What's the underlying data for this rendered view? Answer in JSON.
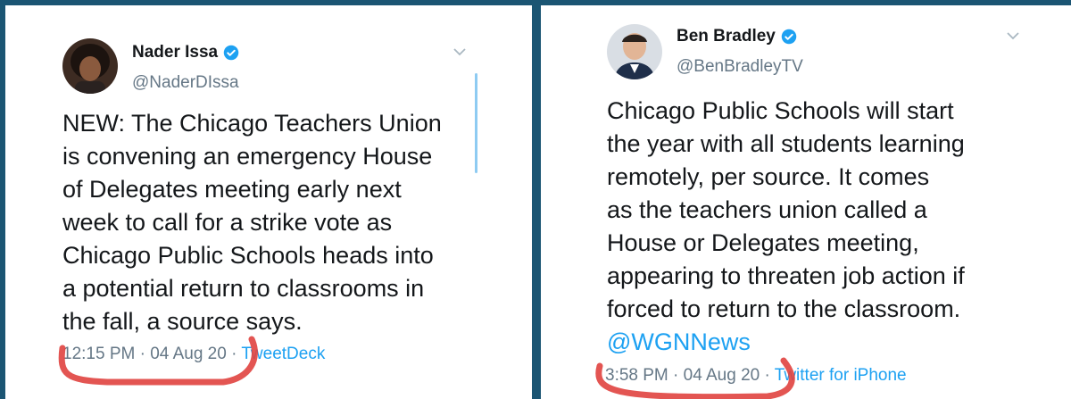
{
  "tweets": [
    {
      "author": "Nader Issa",
      "handle": "@NaderDIssa",
      "text": "NEW: The Chicago Teachers Union\nis convening an emergency House\nof Delegates meeting early next\nweek to call for a strike vote as\nChicago Public Schools heads into\na potential return to classrooms in\nthe fall, a source says.",
      "time": "12:15 PM · 04 Aug 20 ·",
      "source": "TweetDeck",
      "verified": true,
      "menu_icon": "chevron-down-icon"
    },
    {
      "author": "Ben Bradley",
      "handle": "@BenBradleyTV",
      "text": "Chicago Public Schools will start\nthe year with all students learning\nremotely, per source. It comes\nas the teachers union called a\nHouse or Delegates meeting,\nappearing to threaten job action if\nforced to return to the classroom.",
      "mention": "@WGNNews",
      "time": "3:58 PM · 04 Aug 20 ·",
      "source": "Twitter for iPhone",
      "verified": true,
      "menu_icon": "chevron-down-icon"
    }
  ],
  "colors": {
    "background": "#1b5573",
    "panel": "#ffffff",
    "text": "#14171a",
    "secondary": "#657786",
    "link": "#1da1f2",
    "verified": "#1da1f2",
    "annotation": "#e0433f"
  }
}
